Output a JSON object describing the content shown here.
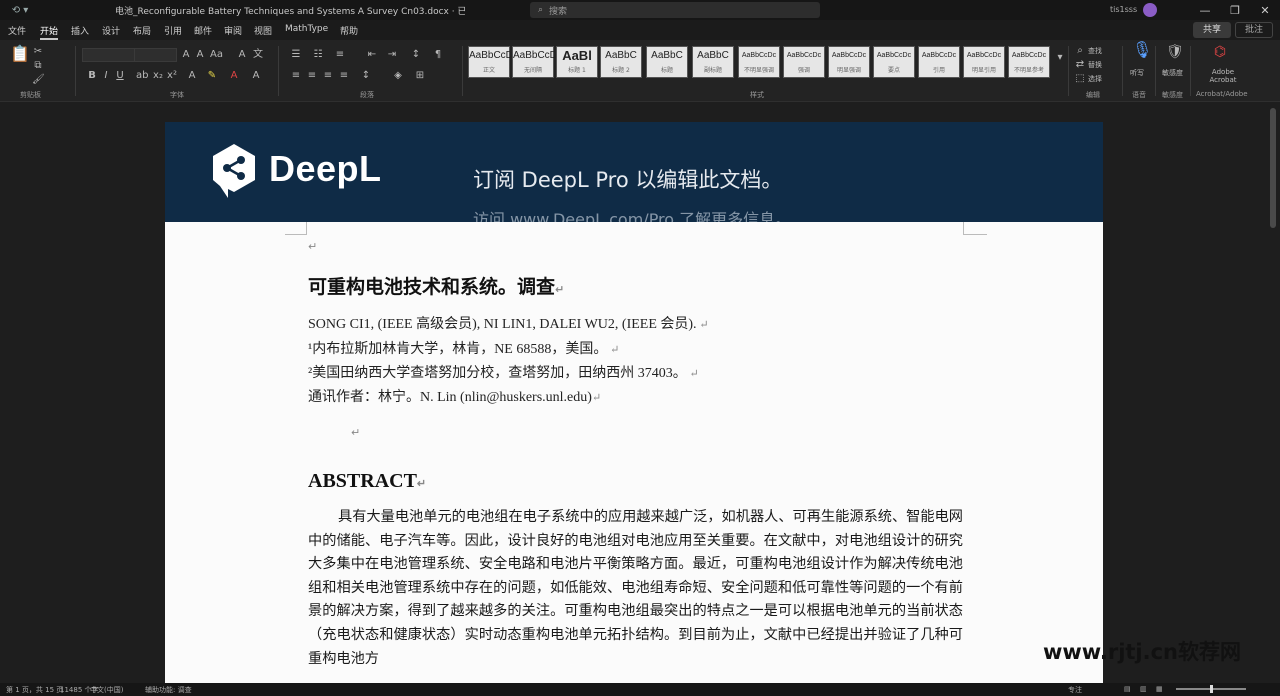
{
  "titlebar": {
    "document_title": "电池_Reconfigurable Battery Techniques and Systems A Survey Cn03.docx · 已保存到此电脑",
    "search_placeholder": "搜索",
    "user_name": "tis1sss",
    "minimize": "—",
    "maximize": "❐",
    "close": "✕"
  },
  "menu": {
    "tabs": [
      "文件",
      "开始",
      "插入",
      "设计",
      "布局",
      "引用",
      "邮件",
      "审阅",
      "视图",
      "MathType",
      "帮助"
    ],
    "active_tab": "开始",
    "share_label": "共享",
    "comment_label": "批注"
  },
  "ribbon": {
    "groups": [
      "剪贴板",
      "字体",
      "段落",
      "样式",
      "编辑",
      "语音",
      "敏感度",
      "Acrobat/Adobe"
    ],
    "styles": [
      {
        "sample": "AaBbCcDc",
        "name": "正文"
      },
      {
        "sample": "AaBbCcDc",
        "name": "无间隔"
      },
      {
        "sample": "AaBl",
        "name": "标题 1"
      },
      {
        "sample": "AaBbC",
        "name": "标题 2"
      },
      {
        "sample": "AaBbC",
        "name": "标题"
      },
      {
        "sample": "AaBbC",
        "name": "副标题"
      },
      {
        "sample": "AaBbCcDc",
        "name": "不明显强调"
      },
      {
        "sample": "AaBbCcDc",
        "name": "强调"
      },
      {
        "sample": "AaBbCcDc",
        "name": "明显强调"
      },
      {
        "sample": "AaBbCcDc",
        "name": "要点"
      },
      {
        "sample": "AaBbCcDc",
        "name": "引用"
      },
      {
        "sample": "AaBbCcDc",
        "name": "明显引用"
      },
      {
        "sample": "AaBbCcDc",
        "name": "不明显参考"
      }
    ],
    "edit_find": "查找",
    "edit_replace": "替换",
    "edit_select": "选择",
    "dictate": "听写",
    "sensitivity": "敏感度",
    "acrobat": "Adobe Acrobat"
  },
  "deepl": {
    "brand": "DeepL",
    "message": "订阅 DeepL Pro 以编辑此文档。",
    "message2": "访问 www.DeepL.com/Pro 了解更多信息。"
  },
  "document": {
    "title": "可重构电池技术和系统。调查",
    "authors": "SONG CI1, (IEEE 高级会员), NI LIN1, DALEI WU2, (IEEE 会员).",
    "affiliation1": "¹内布拉斯加林肯大学，林肯，NE 68588，美国。",
    "affiliation2": "²美国田纳西大学查塔努加分校，查塔努加，田纳西州 37403。",
    "correspondence": "通讯作者：林宁。N. Lin (nlin@huskers.unl.edu)",
    "abstract_heading": "ABSTRACT",
    "abstract_text": "具有大量电池单元的电池组在电子系统中的应用越来越广泛，如机器人、可再生能源系统、智能电网中的储能、电子汽车等。因此，设计良好的电池组对电池应用至关重要。在文献中，对电池组设计的研究大多集中在电池管理系统、安全电路和电池片平衡策略方面。最近，可重构电池组设计作为解决传统电池组和相关电池管理系统中存在的问题，如低能效、电池组寿命短、安全问题和低可靠性等问题的一个有前景的解决方案，得到了越来越多的关注。可重构电池组最突出的特点之一是可以根据电池单元的当前状态（充电状态和健康状态）实时动态重构电池单元拓扑结构。到目前为止，文献中已经提出并验证了几种可重构电池方"
  },
  "statusbar": {
    "page": "第 1 页，共 15 页",
    "words": "11485 个字",
    "language": "中文(中国)",
    "accessibility": "辅助功能: 调查",
    "focus": "专注"
  },
  "watermark": "www.rjtj.cn软荐网"
}
